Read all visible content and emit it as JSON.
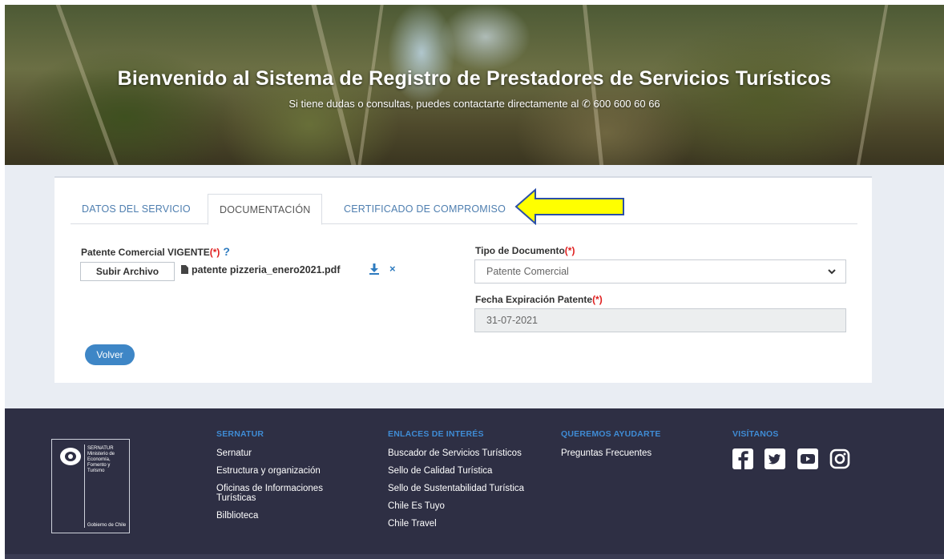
{
  "hero": {
    "title": "Bienvenido al Sistema de Registro de Prestadores de Servicios Turísticos",
    "subtitle": "Si tiene dudas o consultas, puedes contactarte directamente al",
    "phone": "600 600 60 66"
  },
  "tabs": [
    {
      "label": "DATOS DEL SERVICIO",
      "active": false
    },
    {
      "label": "DOCUMENTACIÓN",
      "active": true
    },
    {
      "label": "CERTIFICADO DE COMPROMISO",
      "active": false
    }
  ],
  "form": {
    "patente_label": "Patente Comercial VIGENTE",
    "required_mark": "(*)",
    "help_mark": "?",
    "upload_button": "Subir Archivo",
    "file_name": "patente pizzeria_enero2021.pdf",
    "remove_mark": "×",
    "tipo_label": "Tipo de Documento",
    "tipo_value": "Patente Comercial",
    "fecha_label": "Fecha Expiración Patente",
    "fecha_value": "31-07-2021",
    "volver_button": "Volver"
  },
  "footer": {
    "logo": {
      "brand_line1": "SERNATUR",
      "brand_line2": "Ministerio de",
      "brand_line3": "Economía, Fomento y",
      "brand_line4": "Turismo",
      "gob": "Gobierno de Chile"
    },
    "columns": [
      {
        "heading": "SERNATUR",
        "links": [
          "Sernatur",
          "Estructura y organización",
          "Oficinas de Informaciones Turísticas",
          "Bilblioteca"
        ]
      },
      {
        "heading": "ENLACES DE INTERÉS",
        "links": [
          "Buscador de Servicios Turísticos",
          "Sello de Calidad Turística",
          "Sello de Sustentabilidad Turística",
          "Chile Es Tuyo",
          "Chile Travel"
        ]
      },
      {
        "heading": "QUEREMOS AYUDARTE",
        "links": [
          "Preguntas Frecuentes"
        ]
      },
      {
        "heading": "VISÍTANOS",
        "links": []
      }
    ],
    "social_icons": [
      "facebook-icon",
      "twitter-icon",
      "youtube-icon",
      "instagram-icon"
    ]
  },
  "colors": {
    "accent": "#3e86c6",
    "tab_link": "#4f7fb0",
    "required": "#e02020",
    "footer_bg": "#2e2f44",
    "footer_heading": "#3f8bd4",
    "arrow_fill": "#ffff00"
  }
}
